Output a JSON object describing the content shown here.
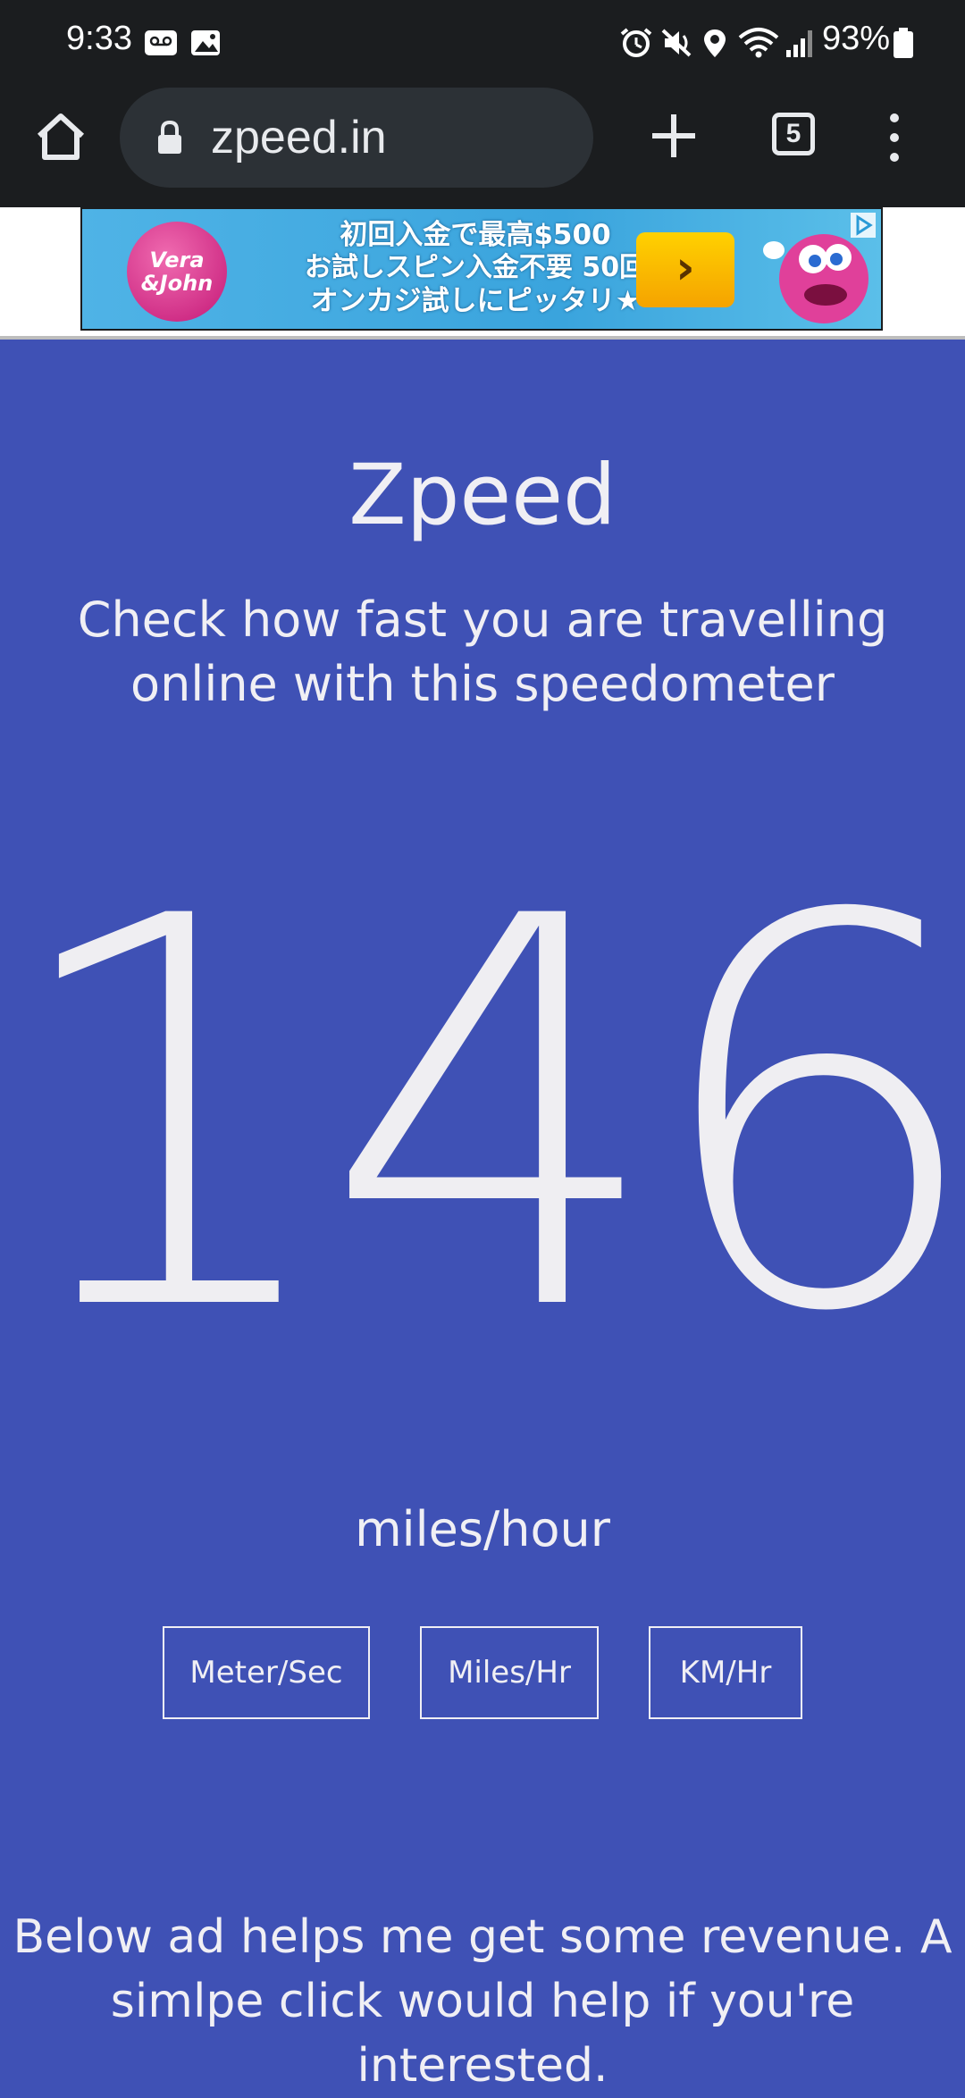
{
  "status_bar": {
    "time": "9:33",
    "battery": "93%",
    "icons": [
      "voicemail-icon",
      "image-icon",
      "alarm-icon",
      "mute-icon",
      "location-icon",
      "wifi-icon",
      "signal-icon",
      "battery-icon"
    ]
  },
  "browser": {
    "url": "zpeed.in",
    "tab_count": "5"
  },
  "ad": {
    "brand_line1": "Vera",
    "brand_line2": "&John",
    "line1": "初回入金で最高$500",
    "line2": "お試しスピン入金不要 50回",
    "line3": "オンカジ試しにピッタリ★",
    "cta": "›"
  },
  "page": {
    "title": "Zpeed",
    "subtitle": "Check how fast you are travelling online with this speedometer",
    "speed": "146",
    "unit": "miles/hour",
    "buttons": {
      "meter_sec": "Meter/Sec",
      "miles_hr": "Miles/Hr",
      "km_hr": "KM/Hr"
    },
    "revenue_note": "Below ad helps me get some revenue. A simlpe click would help if you're interested."
  },
  "colors": {
    "background": "#3f51b5",
    "text": "#f0eff4",
    "toolbar": "#1b1d1f"
  }
}
